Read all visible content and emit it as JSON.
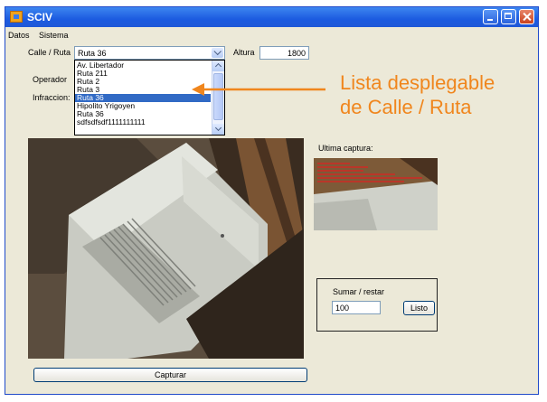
{
  "window": {
    "title": "SCIV"
  },
  "menu": {
    "items": [
      "Datos",
      "Sistema"
    ]
  },
  "form": {
    "calle_label": "Calle / Ruta",
    "calle_value": "Ruta 36",
    "altura_label": "Altura",
    "altura_value": "1800",
    "operador_label": "Operador",
    "infraccion_label": "Infraccion:"
  },
  "dropdown": {
    "items": [
      "Av. Libertador",
      "Ruta 211",
      "Ruta 2",
      "Ruta 3",
      "Ruta 36",
      "Hipolito Yrigoyen",
      "Ruta 36",
      "sdfsdfsdf1111111111"
    ],
    "selected_index": 4
  },
  "capture": {
    "ultima_label": "Ultima captura:",
    "button_label": "Capturar"
  },
  "sumar": {
    "label": "Sumar / restar",
    "value": "100",
    "button_label": "Listo"
  },
  "annotation": {
    "line1": "Lista desplegable",
    "line2": "de Calle / Ruta",
    "color": "#f0861d"
  },
  "colors": {
    "titlebar": "#1c5be0",
    "window_bg": "#ece9d8",
    "selection": "#316ac5"
  }
}
